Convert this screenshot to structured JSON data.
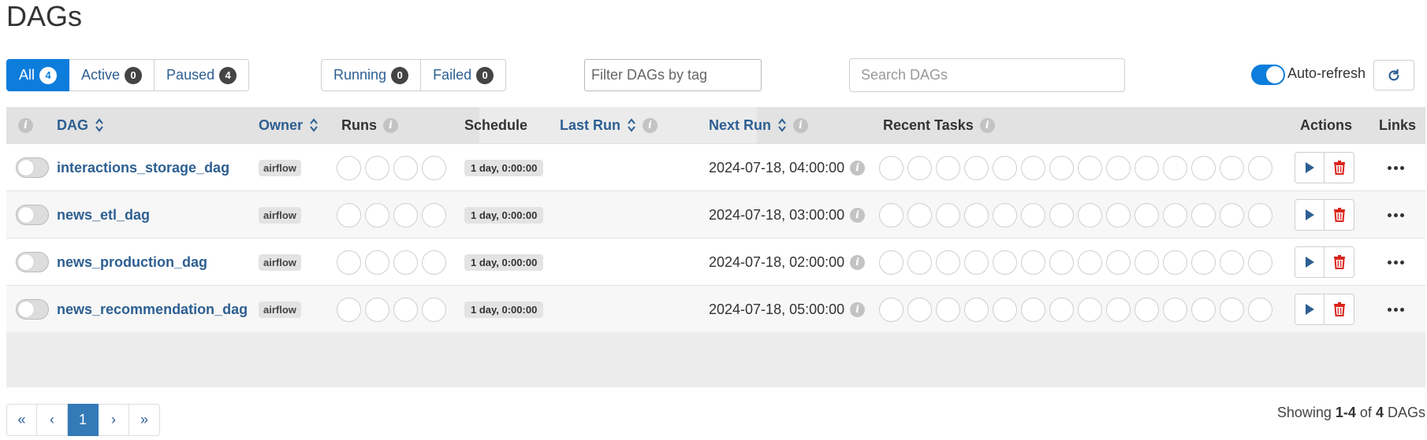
{
  "page": {
    "title": "DAGs"
  },
  "status_filters": [
    {
      "label": "All",
      "count": "4",
      "active": true
    },
    {
      "label": "Active",
      "count": "0",
      "active": false
    },
    {
      "label": "Paused",
      "count": "4",
      "active": false
    }
  ],
  "run_filters": [
    {
      "label": "Running",
      "count": "0"
    },
    {
      "label": "Failed",
      "count": "0"
    }
  ],
  "tag_filter": {
    "placeholder": "Filter DAGs by tag"
  },
  "search": {
    "placeholder": "Search DAGs"
  },
  "auto_refresh": {
    "label": "Auto-refresh",
    "enabled": true
  },
  "columns": {
    "dag": "DAG",
    "owner": "Owner",
    "runs": "Runs",
    "schedule": "Schedule",
    "last_run": "Last Run",
    "next_run": "Next Run",
    "recent_tasks": "Recent Tasks",
    "actions": "Actions",
    "links": "Links"
  },
  "dags": [
    {
      "name": "interactions_storage_dag",
      "owner": "airflow",
      "schedule": "1 day, 0:00:00",
      "last_run": "",
      "next_run": "2024-07-18, 04:00:00",
      "paused": true
    },
    {
      "name": "news_etl_dag",
      "owner": "airflow",
      "schedule": "1 day, 0:00:00",
      "last_run": "",
      "next_run": "2024-07-18, 03:00:00",
      "paused": true
    },
    {
      "name": "news_production_dag",
      "owner": "airflow",
      "schedule": "1 day, 0:00:00",
      "last_run": "",
      "next_run": "2024-07-18, 02:00:00",
      "paused": true
    },
    {
      "name": "news_recommendation_dag",
      "owner": "airflow",
      "schedule": "1 day, 0:00:00",
      "last_run": "",
      "next_run": "2024-07-18, 05:00:00",
      "paused": true
    }
  ],
  "pagination": {
    "first": "«",
    "prev": "‹",
    "current": "1",
    "next": "›",
    "last": "»"
  },
  "showing": {
    "prefix": "Showing",
    "range": "1-4",
    "of": "of",
    "total": "4",
    "suffix": "DAGs"
  },
  "colors": {
    "accent": "#0c7ddb",
    "link": "#2d5f92",
    "delete": "#d9241c",
    "page_active": "#337ab7"
  },
  "icons": {
    "refresh": "refresh-icon",
    "info": "info-icon",
    "sort": "sort-icon",
    "trigger": "play-icon",
    "delete": "trash-icon",
    "links": "more-icon"
  }
}
